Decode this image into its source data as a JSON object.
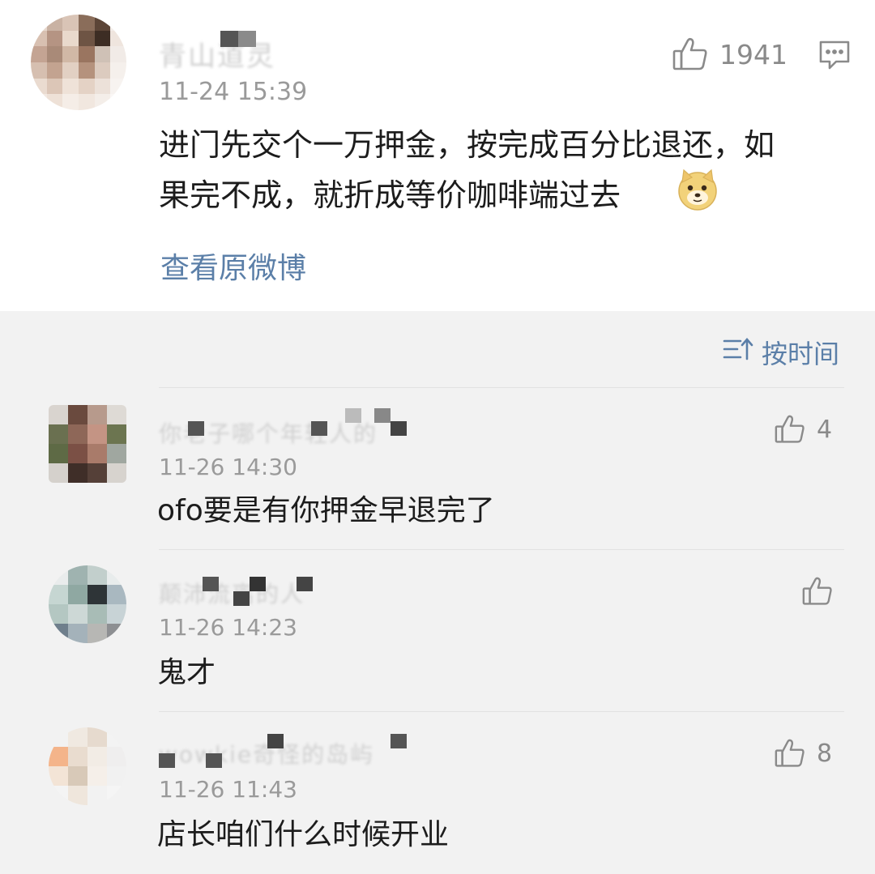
{
  "post": {
    "author": "青山道灵",
    "time": "11-24 15:39",
    "like_count": "1941",
    "text_line1": "进门先交个一万押金，按完成百分比退还，如",
    "text_line2": "果完不成，就折成等价咖啡端过去",
    "view_original": "查看原微博",
    "emoji": "doge-emoji",
    "comment_icon": "comment-icon"
  },
  "sort": {
    "label": "按时间",
    "icon": "sort-icon"
  },
  "comments": [
    {
      "author": "你老子哪个年轻人的",
      "time": "11-26 14:30",
      "text": "ofo要是有你押金早退完了",
      "likes": "4"
    },
    {
      "author": "颠沛流离的人",
      "time": "11-26 14:23",
      "text": "鬼才",
      "likes": ""
    },
    {
      "author": "wowkie奇怪的岛屿",
      "time": "11-26 11:43",
      "text": "店长咱们什么时候开业",
      "likes": "8"
    }
  ],
  "colors": {
    "link": "#5b7fa8",
    "background": "#f2f2f2",
    "card": "#ffffff"
  }
}
